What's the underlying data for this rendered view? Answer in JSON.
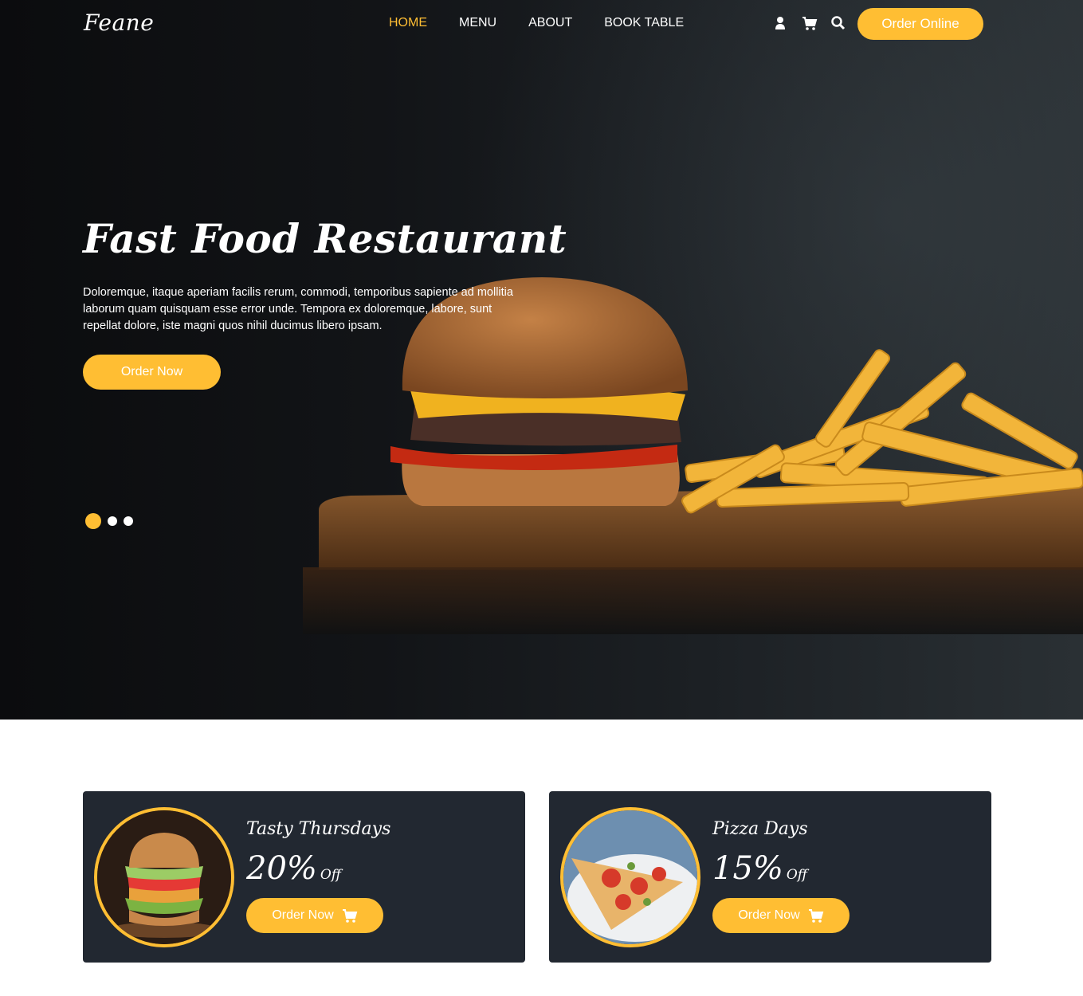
{
  "brand": {
    "logo": "Feane",
    "accent_color": "#ffbe33",
    "dark_color": "#222831"
  },
  "nav": {
    "items": [
      "HOME",
      "MENU",
      "ABOUT",
      "BOOK TABLE"
    ],
    "active": "HOME"
  },
  "header_icons": [
    "user-icon",
    "cart-icon",
    "search-icon"
  ],
  "header_button": "Order Online",
  "hero": {
    "title": "Fast Food Restaurant",
    "text": "Doloremque, itaque aperiam facilis rerum, commodi, temporibus sapiente ad mollitia laborum quam quisquam esse error unde. Tempora ex doloremque, labore, sunt repellat dolore, iste magni quos nihil ducimus libero ipsam.",
    "button": "Order Now",
    "slides": 3,
    "active_slide": 1
  },
  "offers": [
    {
      "title": "Tasty Thursdays",
      "percent": "20%",
      "off": "Off",
      "button": "Order Now"
    },
    {
      "title": "Pizza Days",
      "percent": "15%",
      "off": "Off",
      "button": "Order Now"
    }
  ]
}
